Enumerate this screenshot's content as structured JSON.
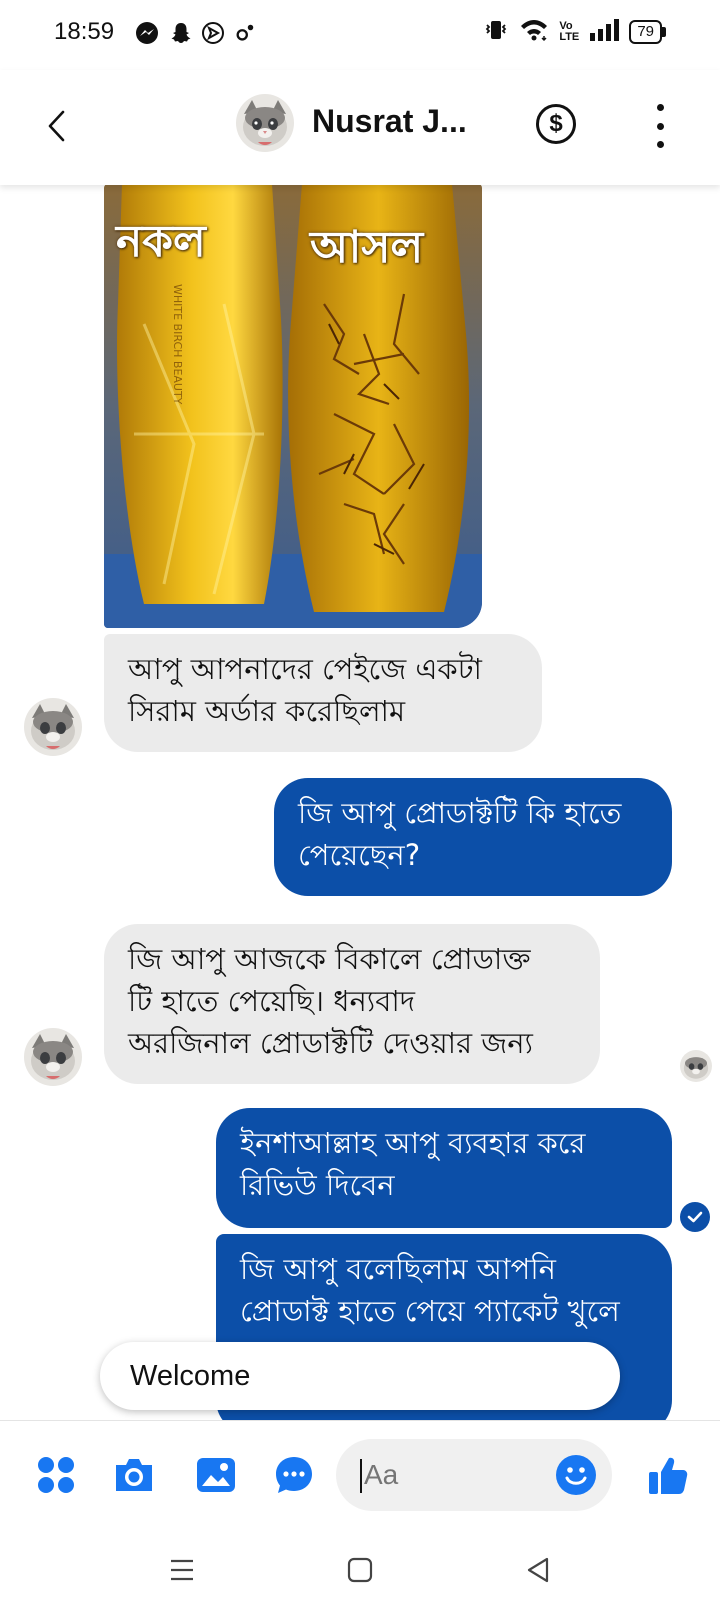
{
  "status_bar": {
    "time": "18:59",
    "network_label": "Vo LTE",
    "battery": "79"
  },
  "header": {
    "contact_name": "Nusrat J...",
    "back_icon": "chevron-left-icon",
    "payment_icon": "dollar-icon",
    "more_icon": "more-vertical-icon"
  },
  "photo": {
    "left_label": "নকল",
    "right_label": "আসল",
    "bottle_text": "WHITE BIRCH BEAUTY"
  },
  "messages": [
    {
      "direction": "incoming",
      "lines": [
        "আপু আপনাদের পেইজে একটা",
        "সিরাম অর্ডার করেছিলাম"
      ]
    },
    {
      "direction": "outgoing",
      "lines": [
        "জি আপু প্রোডাক্টটি কি হাতে",
        "পেয়েছেন?"
      ]
    },
    {
      "direction": "incoming",
      "lines": [
        "জি আপু আজকে বিকালে প্রোডাক্ত",
        "টি হাতে পেয়েছি। ধন্যবাদ",
        "অরজিনাল প্রোডাক্টটি দেওয়ার জন্য"
      ]
    },
    {
      "direction": "outgoing",
      "lines": [
        "ইনশাআল্লাহ আপু ব্যবহার করে",
        "রিভিউ দিবেন"
      ]
    },
    {
      "direction": "outgoing",
      "lines": [
        "জি আপু বলেছিলাম আপনি",
        "প্রোডাক্ট হাতে পেয়ে প্যাকেট খুলে"
      ]
    }
  ],
  "quick_reply": {
    "label": "Welcome"
  },
  "composer": {
    "placeholder": "Aa"
  },
  "colors": {
    "outgoing_bubble": "#0c4fa8",
    "incoming_bubble": "#ebebeb",
    "messenger_blue": "#1877f2"
  }
}
